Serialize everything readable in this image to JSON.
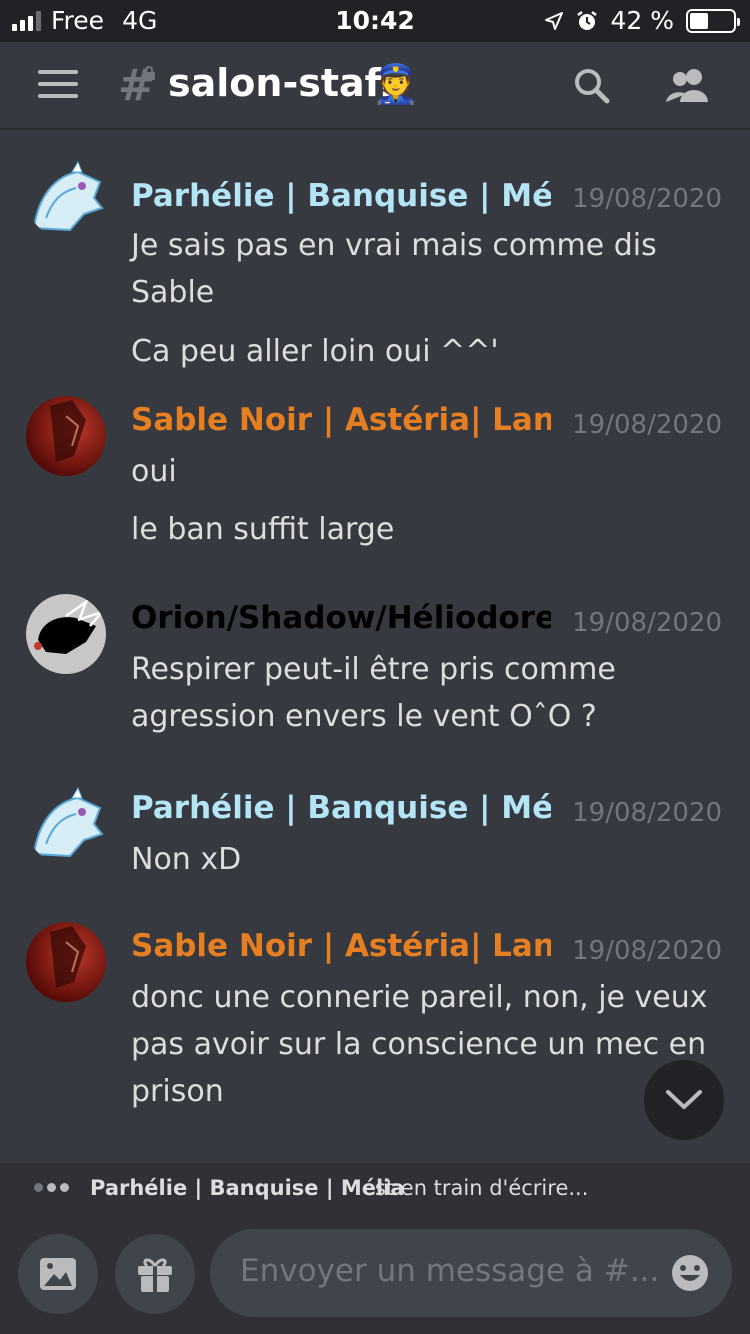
{
  "status_bar": {
    "carrier": "Free",
    "network": "4G",
    "time": "10:42",
    "battery": "42 %",
    "battery_level": 0.42
  },
  "header": {
    "channel_name": "salon-staff",
    "channel_emoji": "👮",
    "icons": [
      "menu-icon",
      "locked-hash-icon",
      "search-icon",
      "members-icon"
    ]
  },
  "messages": [
    {
      "author": "Parhélie | Banquise | Mé...",
      "author_color": "#b3e5f6",
      "timestamp": "19/08/2020",
      "lines": [
        "Je sais pas en vrai mais comme dis Sable",
        "Ca peu aller loin oui ^^'"
      ]
    },
    {
      "author": "Sable Noir | Astéria| Lan...",
      "author_color": "#e67e22",
      "timestamp": "19/08/2020",
      "lines": [
        "oui",
        "le ban suffit large"
      ]
    },
    {
      "author": "Orion/Shadow/Héliodore",
      "author_color": "#000000",
      "timestamp": "19/08/2020",
      "lines": [
        "Respirer peut-il être pris comme agression envers le vent OˆO ?"
      ]
    },
    {
      "author": "Parhélie | Banquise | Mé...",
      "author_color": "#b3e5f6",
      "timestamp": "19/08/2020",
      "lines": [
        "Non xD"
      ]
    },
    {
      "author": "Sable Noir | Astéria| Lan...",
      "author_color": "#e67e22",
      "timestamp": "19/08/2020",
      "lines": [
        "donc une connerie pareil, non, je veux pas avoir sur la conscience un mec en prison"
      ]
    }
  ],
  "typing": {
    "who": "Parhélie | Banquise | Mélia",
    "text": "est en train d'écrire..."
  },
  "composer": {
    "placeholder": "Envoyer un message à #...",
    "icons": [
      "image-icon",
      "gift-icon",
      "emoji-icon"
    ]
  },
  "colors": {
    "background": "#36393f",
    "statusbar": "#202225",
    "timestamp": "#72767d"
  }
}
